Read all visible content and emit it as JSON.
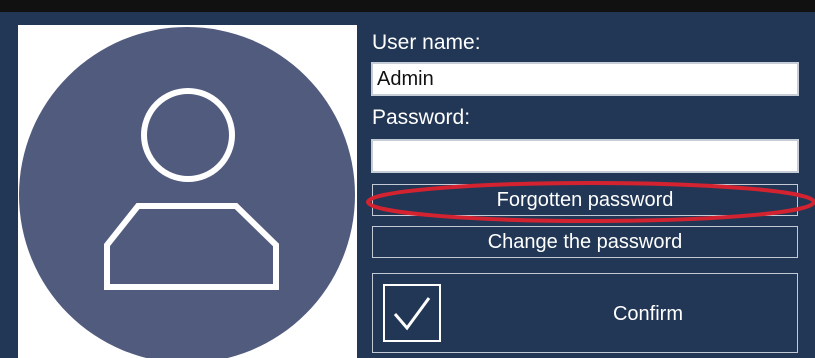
{
  "form": {
    "username_label": "User name:",
    "username_value": "Admin",
    "password_label": "Password:",
    "password_value": ""
  },
  "buttons": {
    "forgotten_password": "Forgotten password",
    "change_password": "Change the password",
    "confirm": "Confirm"
  },
  "icons": {
    "avatar": "user-avatar-icon",
    "confirm": "checkmark-icon"
  },
  "colors": {
    "panel_background": "#223755",
    "avatar_circle": "#515b7e",
    "highlight": "#d42330"
  }
}
